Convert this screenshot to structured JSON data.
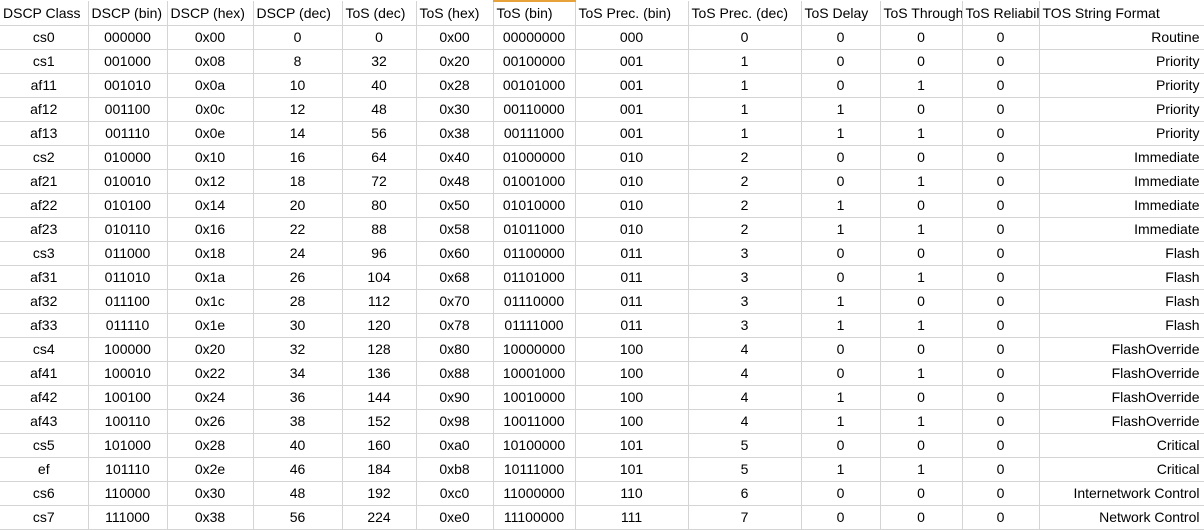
{
  "headers": [
    "DSCP Class",
    "DSCP (bin)",
    "DSCP (hex)",
    "DSCP (dec)",
    "ToS (dec)",
    "ToS (hex)",
    "ToS (bin)",
    "ToS Prec. (bin)",
    "ToS Prec. (dec)",
    "ToS Delay",
    "ToS Throughput",
    "ToS Reliability",
    "TOS String Format"
  ],
  "selected_header": "ToS (bin)",
  "rows": [
    [
      "cs0",
      "000000",
      "0x00",
      "0",
      "0",
      "0x00",
      "00000000",
      "000",
      "0",
      "0",
      "0",
      "0",
      "Routine"
    ],
    [
      "cs1",
      "001000",
      "0x08",
      "8",
      "32",
      "0x20",
      "00100000",
      "001",
      "1",
      "0",
      "0",
      "0",
      "Priority"
    ],
    [
      "af11",
      "001010",
      "0x0a",
      "10",
      "40",
      "0x28",
      "00101000",
      "001",
      "1",
      "0",
      "1",
      "0",
      "Priority"
    ],
    [
      "af12",
      "001100",
      "0x0c",
      "12",
      "48",
      "0x30",
      "00110000",
      "001",
      "1",
      "1",
      "0",
      "0",
      "Priority"
    ],
    [
      "af13",
      "001110",
      "0x0e",
      "14",
      "56",
      "0x38",
      "00111000",
      "001",
      "1",
      "1",
      "1",
      "0",
      "Priority"
    ],
    [
      "cs2",
      "010000",
      "0x10",
      "16",
      "64",
      "0x40",
      "01000000",
      "010",
      "2",
      "0",
      "0",
      "0",
      "Immediate"
    ],
    [
      "af21",
      "010010",
      "0x12",
      "18",
      "72",
      "0x48",
      "01001000",
      "010",
      "2",
      "0",
      "1",
      "0",
      "Immediate"
    ],
    [
      "af22",
      "010100",
      "0x14",
      "20",
      "80",
      "0x50",
      "01010000",
      "010",
      "2",
      "1",
      "0",
      "0",
      "Immediate"
    ],
    [
      "af23",
      "010110",
      "0x16",
      "22",
      "88",
      "0x58",
      "01011000",
      "010",
      "2",
      "1",
      "1",
      "0",
      "Immediate"
    ],
    [
      "cs3",
      "011000",
      "0x18",
      "24",
      "96",
      "0x60",
      "01100000",
      "011",
      "3",
      "0",
      "0",
      "0",
      "Flash"
    ],
    [
      "af31",
      "011010",
      "0x1a",
      "26",
      "104",
      "0x68",
      "01101000",
      "011",
      "3",
      "0",
      "1",
      "0",
      "Flash"
    ],
    [
      "af32",
      "011100",
      "0x1c",
      "28",
      "112",
      "0x70",
      "01110000",
      "011",
      "3",
      "1",
      "0",
      "0",
      "Flash"
    ],
    [
      "af33",
      "011110",
      "0x1e",
      "30",
      "120",
      "0x78",
      "01111000",
      "011",
      "3",
      "1",
      "1",
      "0",
      "Flash"
    ],
    [
      "cs4",
      "100000",
      "0x20",
      "32",
      "128",
      "0x80",
      "10000000",
      "100",
      "4",
      "0",
      "0",
      "0",
      "FlashOverride"
    ],
    [
      "af41",
      "100010",
      "0x22",
      "34",
      "136",
      "0x88",
      "10001000",
      "100",
      "4",
      "0",
      "1",
      "0",
      "FlashOverride"
    ],
    [
      "af42",
      "100100",
      "0x24",
      "36",
      "144",
      "0x90",
      "10010000",
      "100",
      "4",
      "1",
      "0",
      "0",
      "FlashOverride"
    ],
    [
      "af43",
      "100110",
      "0x26",
      "38",
      "152",
      "0x98",
      "10011000",
      "100",
      "4",
      "1",
      "1",
      "0",
      "FlashOverride"
    ],
    [
      "cs5",
      "101000",
      "0x28",
      "40",
      "160",
      "0xa0",
      "10100000",
      "101",
      "5",
      "0",
      "0",
      "0",
      "Critical"
    ],
    [
      "ef",
      "101110",
      "0x2e",
      "46",
      "184",
      "0xb8",
      "10111000",
      "101",
      "5",
      "1",
      "1",
      "0",
      "Critical"
    ],
    [
      "cs6",
      "110000",
      "0x30",
      "48",
      "192",
      "0xc0",
      "11000000",
      "110",
      "6",
      "0",
      "0",
      "0",
      "Internetwork Control"
    ],
    [
      "cs7",
      "111000",
      "0x38",
      "56",
      "224",
      "0xe0",
      "11100000",
      "111",
      "7",
      "0",
      "0",
      "0",
      "Network Control"
    ]
  ]
}
